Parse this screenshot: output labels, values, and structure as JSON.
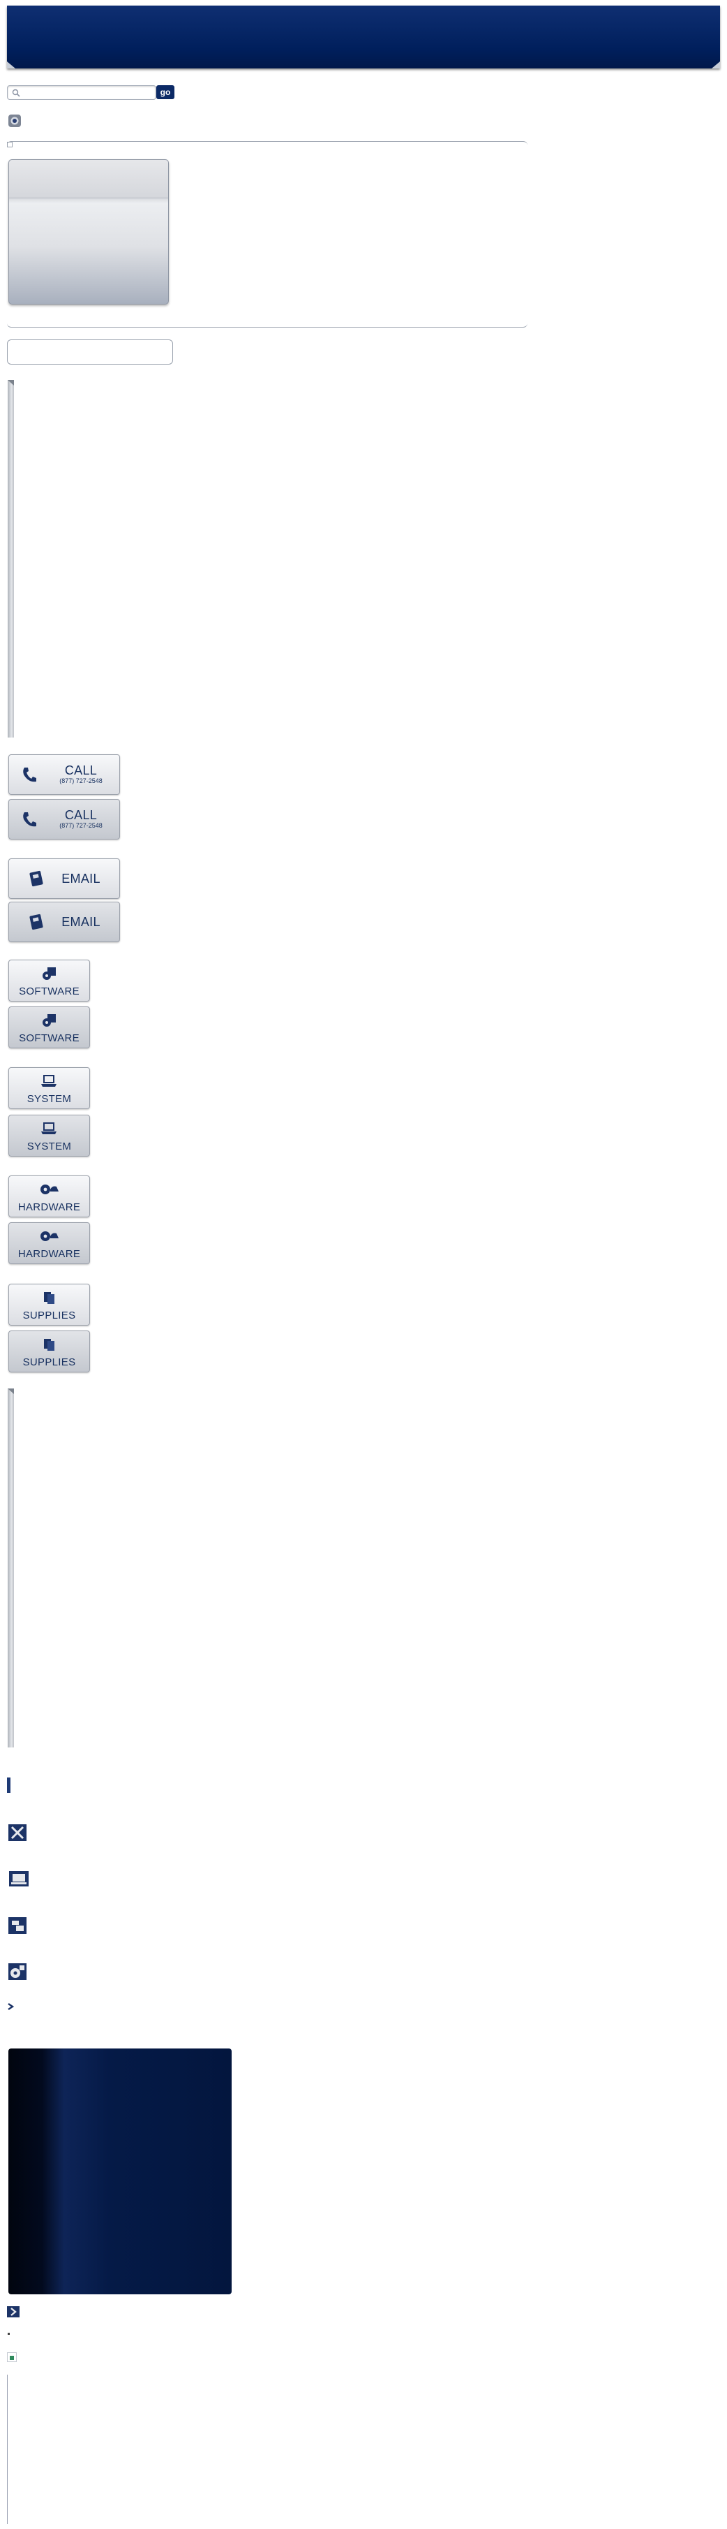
{
  "search": {
    "value": "",
    "placeholder": "",
    "go_label": "go"
  },
  "contact": {
    "call": {
      "label": "CALL",
      "phone": "(877) 727-2548"
    },
    "email": {
      "label": "EMAIL"
    }
  },
  "categories": [
    {
      "label": "SOFTWARE",
      "icon": "software-icon"
    },
    {
      "label": "SYSTEM",
      "icon": "system-icon"
    },
    {
      "label": "HARDWARE",
      "icon": "hardware-icon"
    },
    {
      "label": "SUPPLIES",
      "icon": "supplies-icon"
    }
  ],
  "colors": {
    "brand": "#001f5c",
    "accent": "#0c2a66",
    "tile_text": "#17305f"
  }
}
